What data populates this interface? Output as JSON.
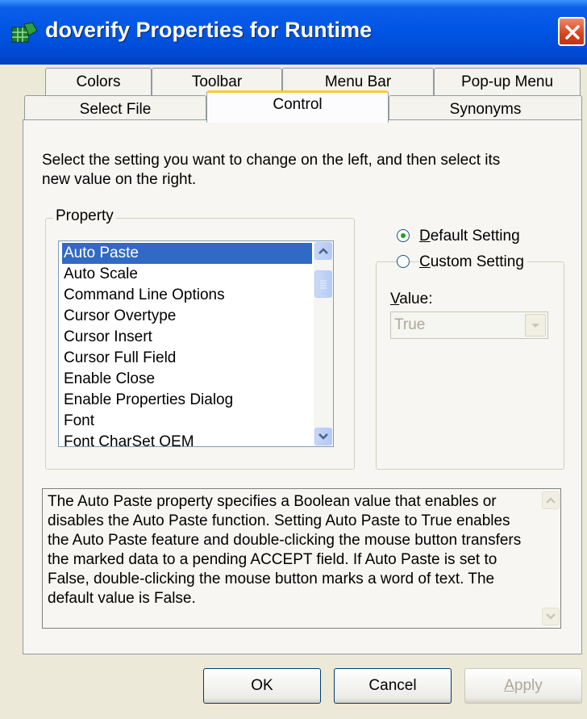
{
  "window": {
    "title": "doverify Properties for Runtime",
    "icon": "app-grid-icon",
    "accent": "#0054e3"
  },
  "tabs": {
    "row1": [
      "Colors",
      "Toolbar",
      "Menu Bar",
      "Pop-up Menu"
    ],
    "row2": [
      "Select File",
      "Control",
      "Synonyms"
    ],
    "active": "Control"
  },
  "instructions": "Select the setting you want to change on the left, and then select its new value on the right.",
  "property_group": {
    "legend": "Property",
    "items": [
      "Auto Paste",
      "Auto Scale",
      "Command Line Options",
      "Cursor Overtype",
      "Cursor Insert",
      "Cursor Full Field",
      "Enable Close",
      "Enable Properties Dialog",
      "Font",
      "Font CharSet OEM"
    ],
    "selected": "Auto Paste"
  },
  "setting": {
    "default_label_u": "D",
    "default_label_rest": "efault Setting",
    "custom_label_u": "C",
    "custom_label_rest": "ustom Setting",
    "selected": "default",
    "value_label_u": "V",
    "value_label_rest": "alue:",
    "value": "True"
  },
  "description": "The Auto Paste property specifies a Boolean value that enables or disables the Auto Paste function.  Setting Auto Paste to True enables the Auto Paste feature and double-clicking the mouse button transfers the marked data to a pending ACCEPT field.  If Auto Paste is set to False, double-clicking the mouse button marks a word of text.  The default value is False.",
  "buttons": {
    "ok": "OK",
    "cancel": "Cancel",
    "apply_u": "A",
    "apply_rest": "pply"
  }
}
